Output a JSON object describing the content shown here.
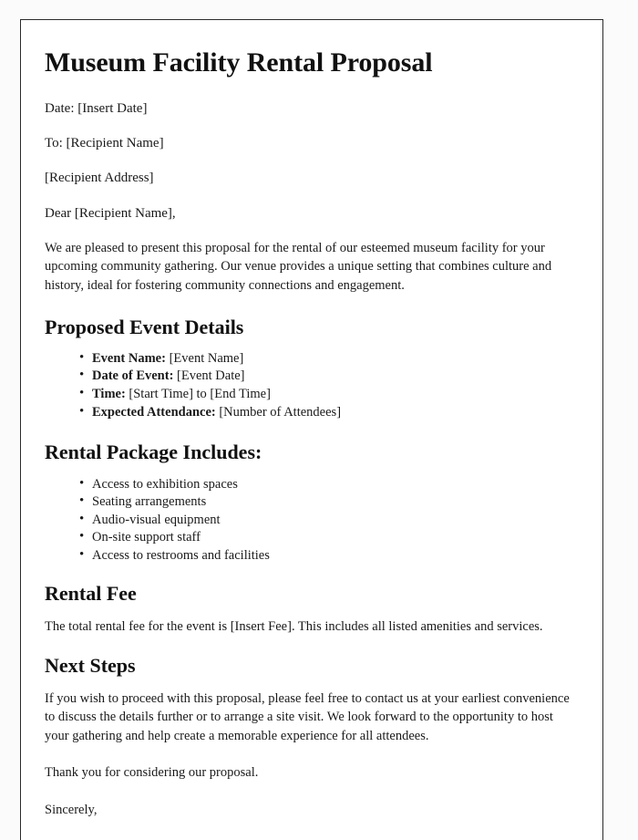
{
  "document": {
    "title": "Museum Facility Rental Proposal",
    "header_lines": [
      "Date: [Insert Date]",
      "To: [Recipient Name]",
      "[Recipient Address]",
      "Dear [Recipient Name],"
    ],
    "intro_paragraph": "We are pleased to present this proposal for the rental of our esteemed museum facility for your upcoming community gathering. Our venue provides a unique setting that combines culture and history, ideal for fostering community connections and engagement.",
    "sections": [
      {
        "heading": "Proposed Event Details",
        "items": [
          {
            "label": "Event Name:",
            "value": "[Event Name]"
          },
          {
            "label": "Date of Event:",
            "value": "[Event Date]"
          },
          {
            "label": "Time:",
            "value": "[Start Time] to [End Time]"
          },
          {
            "label": "Expected Attendance:",
            "value": "[Number of Attendees]"
          }
        ]
      },
      {
        "heading": "Rental Package Includes:",
        "items": [
          {
            "label": "",
            "value": "Access to exhibition spaces"
          },
          {
            "label": "",
            "value": "Seating arrangements"
          },
          {
            "label": "",
            "value": "Audio-visual equipment"
          },
          {
            "label": "",
            "value": "On-site support staff"
          },
          {
            "label": "",
            "value": "Access to restrooms and facilities"
          }
        ]
      },
      {
        "heading": "Rental Fee",
        "paragraph": "The total rental fee for the event is [Insert Fee]. This includes all listed amenities and services."
      },
      {
        "heading": "Next Steps",
        "paragraph": "If you wish to proceed with this proposal, please feel free to contact us at your earliest convenience to discuss the details further or to arrange a site visit. We look forward to the opportunity to host your gathering and help create a memorable experience for all attendees."
      }
    ],
    "thank_you": "Thank you for considering our proposal.",
    "sign_off": "Sincerely,"
  },
  "colors": {
    "page_background": "#ffffff",
    "canvas_background": "#fbfbfb",
    "border": "#2b2b2b",
    "text": "#1a1a1a",
    "heading": "#111111"
  }
}
